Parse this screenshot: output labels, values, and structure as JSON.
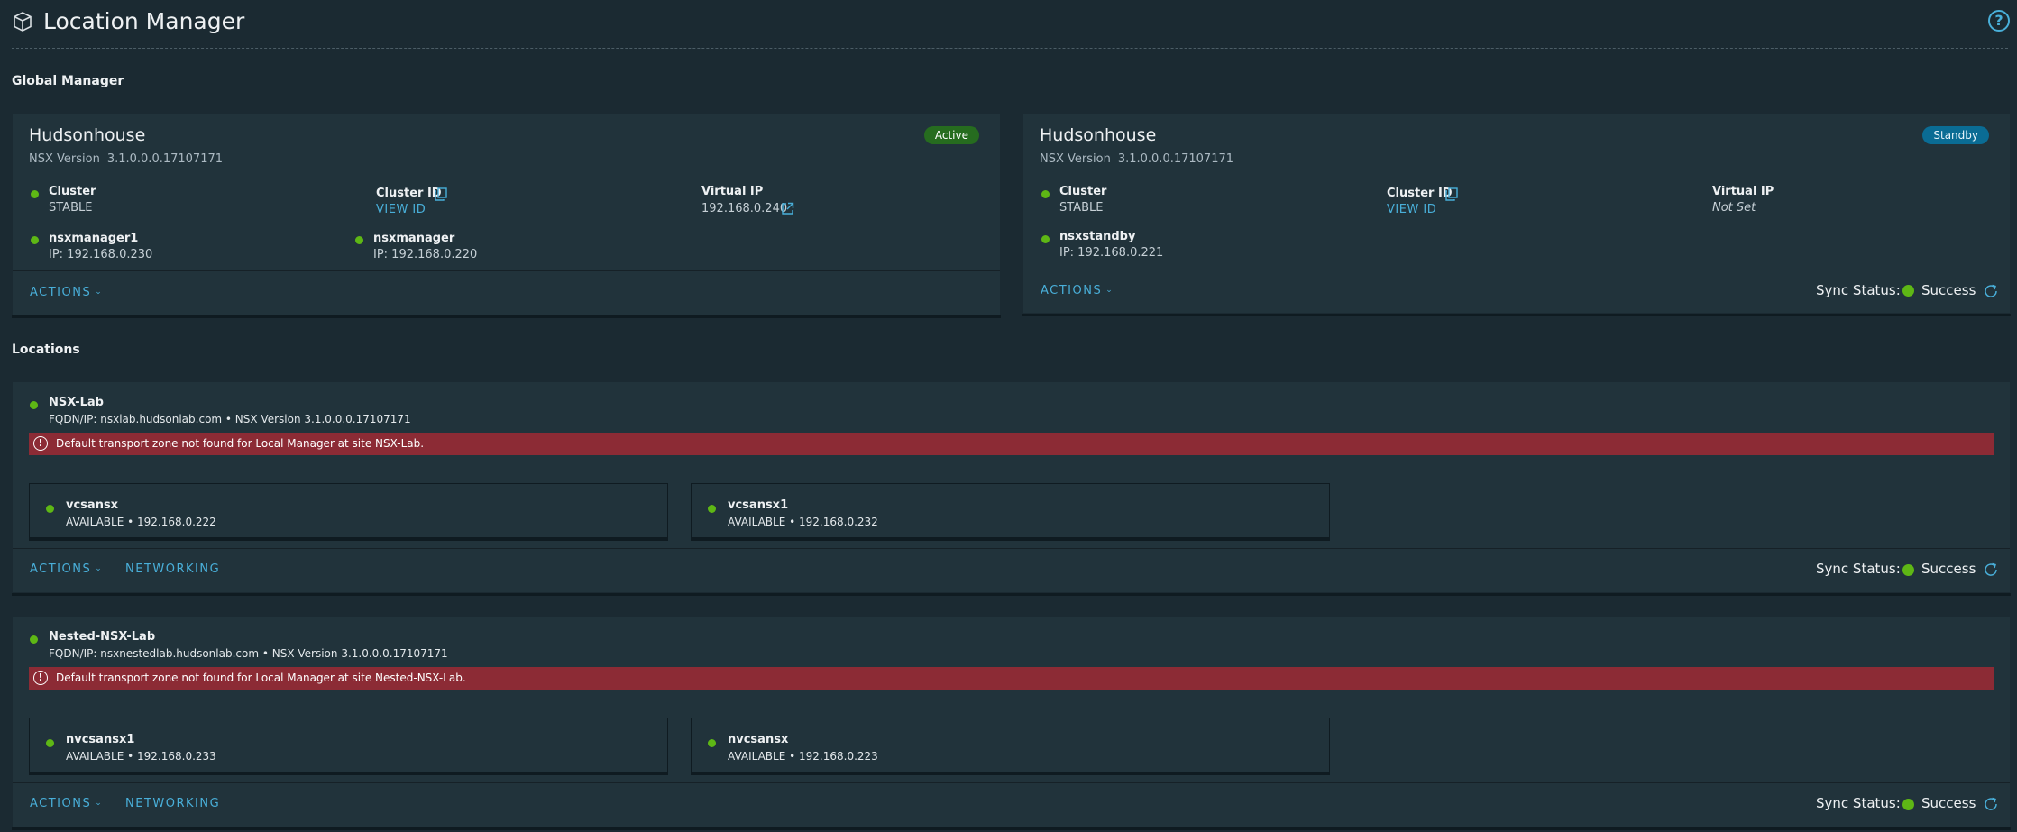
{
  "header": {
    "title": "Location Manager",
    "icon": "box-icon",
    "help_icon": "help-icon",
    "help_glyph": "?"
  },
  "global_manager": {
    "section_title": "Global Manager",
    "cards": [
      {
        "name": "Hudsonhouse",
        "version_label": "NSX Version",
        "version": "3.1.0.0.0.17107171",
        "status": "Active",
        "cluster_label": "Cluster",
        "cluster_value": "STABLE",
        "cluster_id_label": "Cluster ID",
        "cluster_id_link": "VIEW ID",
        "vip_label": "Virtual IP",
        "vip_value": "192.168.0.240",
        "nodes": [
          {
            "name": "nsxmanager1",
            "ip": "IP: 192.168.0.230"
          },
          {
            "name": "nsxmanager",
            "ip": "IP: 192.168.0.220"
          }
        ],
        "actions_label": "ACTIONS"
      },
      {
        "name": "Hudsonhouse",
        "version_label": "NSX Version",
        "version": "3.1.0.0.0.17107171",
        "status": "Standby",
        "cluster_label": "Cluster",
        "cluster_value": "STABLE",
        "cluster_id_label": "Cluster ID",
        "cluster_id_link": "VIEW ID",
        "vip_label": "Virtual IP",
        "vip_value": "Not Set",
        "nodes": [
          {
            "name": "nsxstandby",
            "ip": "IP: 192.168.0.221"
          }
        ],
        "actions_label": "ACTIONS",
        "sync_label": "Sync Status:",
        "sync_value": "Success"
      }
    ]
  },
  "locations": {
    "section_title": "Locations",
    "items": [
      {
        "name": "NSX-Lab",
        "fqdn": "FQDN/IP: nsxlab.hudsonlab.com • NSX Version 3.1.0.0.0.17107171",
        "alert": "Default transport zone not found for Local Manager at site NSX-Lab.",
        "vcenters": [
          {
            "name": "vcsansx",
            "detail": "AVAILABLE • 192.168.0.222"
          },
          {
            "name": "vcsansx1",
            "detail": "AVAILABLE • 192.168.0.232"
          }
        ],
        "actions_label": "ACTIONS",
        "networking_label": "NETWORKING",
        "sync_label": "Sync Status:",
        "sync_value": "Success"
      },
      {
        "name": "Nested-NSX-Lab",
        "fqdn": "FQDN/IP: nsxnestedlab.hudsonlab.com • NSX Version 3.1.0.0.0.17107171",
        "alert": "Default transport zone not found for Local Manager at site Nested-NSX-Lab.",
        "vcenters": [
          {
            "name": "nvcsansx1",
            "detail": "AVAILABLE • 192.168.0.233"
          },
          {
            "name": "nvcsansx",
            "detail": "AVAILABLE • 192.168.0.223"
          }
        ],
        "actions_label": "ACTIONS",
        "networking_label": "NETWORKING",
        "sync_label": "Sync Status:",
        "sync_value": "Success"
      }
    ]
  },
  "colors": {
    "background": "#1b2a32",
    "card": "#21333b",
    "accent_link": "#49afd9",
    "status_green": "#5eb715",
    "alert_red": "#8c2b35",
    "badge_active": "#266c1f",
    "badge_standby": "#0a6c94"
  }
}
